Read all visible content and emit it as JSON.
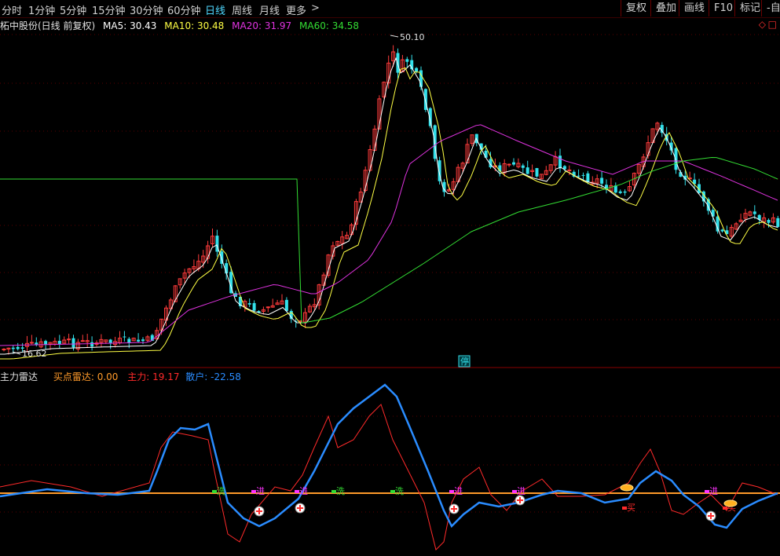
{
  "toolbar": {
    "periods": [
      {
        "label": "分时",
        "active": false
      },
      {
        "label": "1分钟",
        "active": false
      },
      {
        "label": "5分钟",
        "active": false
      },
      {
        "label": "15分钟",
        "active": false
      },
      {
        "label": "30分钟",
        "active": false
      },
      {
        "label": "60分钟",
        "active": false
      },
      {
        "label": "日线",
        "active": true
      },
      {
        "label": "周线",
        "active": false
      },
      {
        "label": "月线",
        "active": false
      },
      {
        "label": "更多",
        "active": false
      }
    ],
    "more_arrow": ">",
    "buttons": [
      "复权",
      "叠加",
      "画线",
      "F10",
      "标记",
      "-自"
    ]
  },
  "main_chart": {
    "title": "柘中股份(日线 前复权)",
    "ma5_label": "MA5: 30.43",
    "ma10_label": "MA10: 30.48",
    "ma20_label": "MA20: 31.97",
    "ma60_label": "MA60: 34.58",
    "high_label": "50.10",
    "low_label": "16.62",
    "halt_marker": "停",
    "diamond": "◇",
    "square": "□",
    "colors": {
      "up": "#ff3b3b",
      "down": "#33e0ea",
      "ma5": "#ffffff",
      "ma10": "#ffff44",
      "ma20": "#e033e0",
      "ma60": "#33dd33",
      "grid": "#5a0000",
      "divider": "#8a0000"
    }
  },
  "indicator": {
    "name": "主力雷达",
    "buy_radar_label": "买点雷达: 0.00",
    "main_force_label": "主力: 19.17",
    "retail_label": "散户: -22.58",
    "colors": {
      "buy_radar": "#ff9a2a",
      "main_force": "#ff2a2a",
      "retail": "#2a8cff"
    },
    "signals": [
      {
        "text": "洗",
        "color": "#33dd33"
      },
      {
        "text": "进",
        "color": "#ff33ff"
      },
      {
        "text": "进",
        "color": "#ff33ff"
      },
      {
        "text": "洗",
        "color": "#33dd33"
      },
      {
        "text": "洗",
        "color": "#33dd33"
      },
      {
        "text": "进",
        "color": "#ff33ff"
      },
      {
        "text": "进",
        "color": "#ff33ff"
      },
      {
        "text": "买",
        "color": "#ff2a2a"
      },
      {
        "text": "进",
        "color": "#ff33ff"
      },
      {
        "text": "买",
        "color": "#ff2a2a"
      }
    ]
  }
}
